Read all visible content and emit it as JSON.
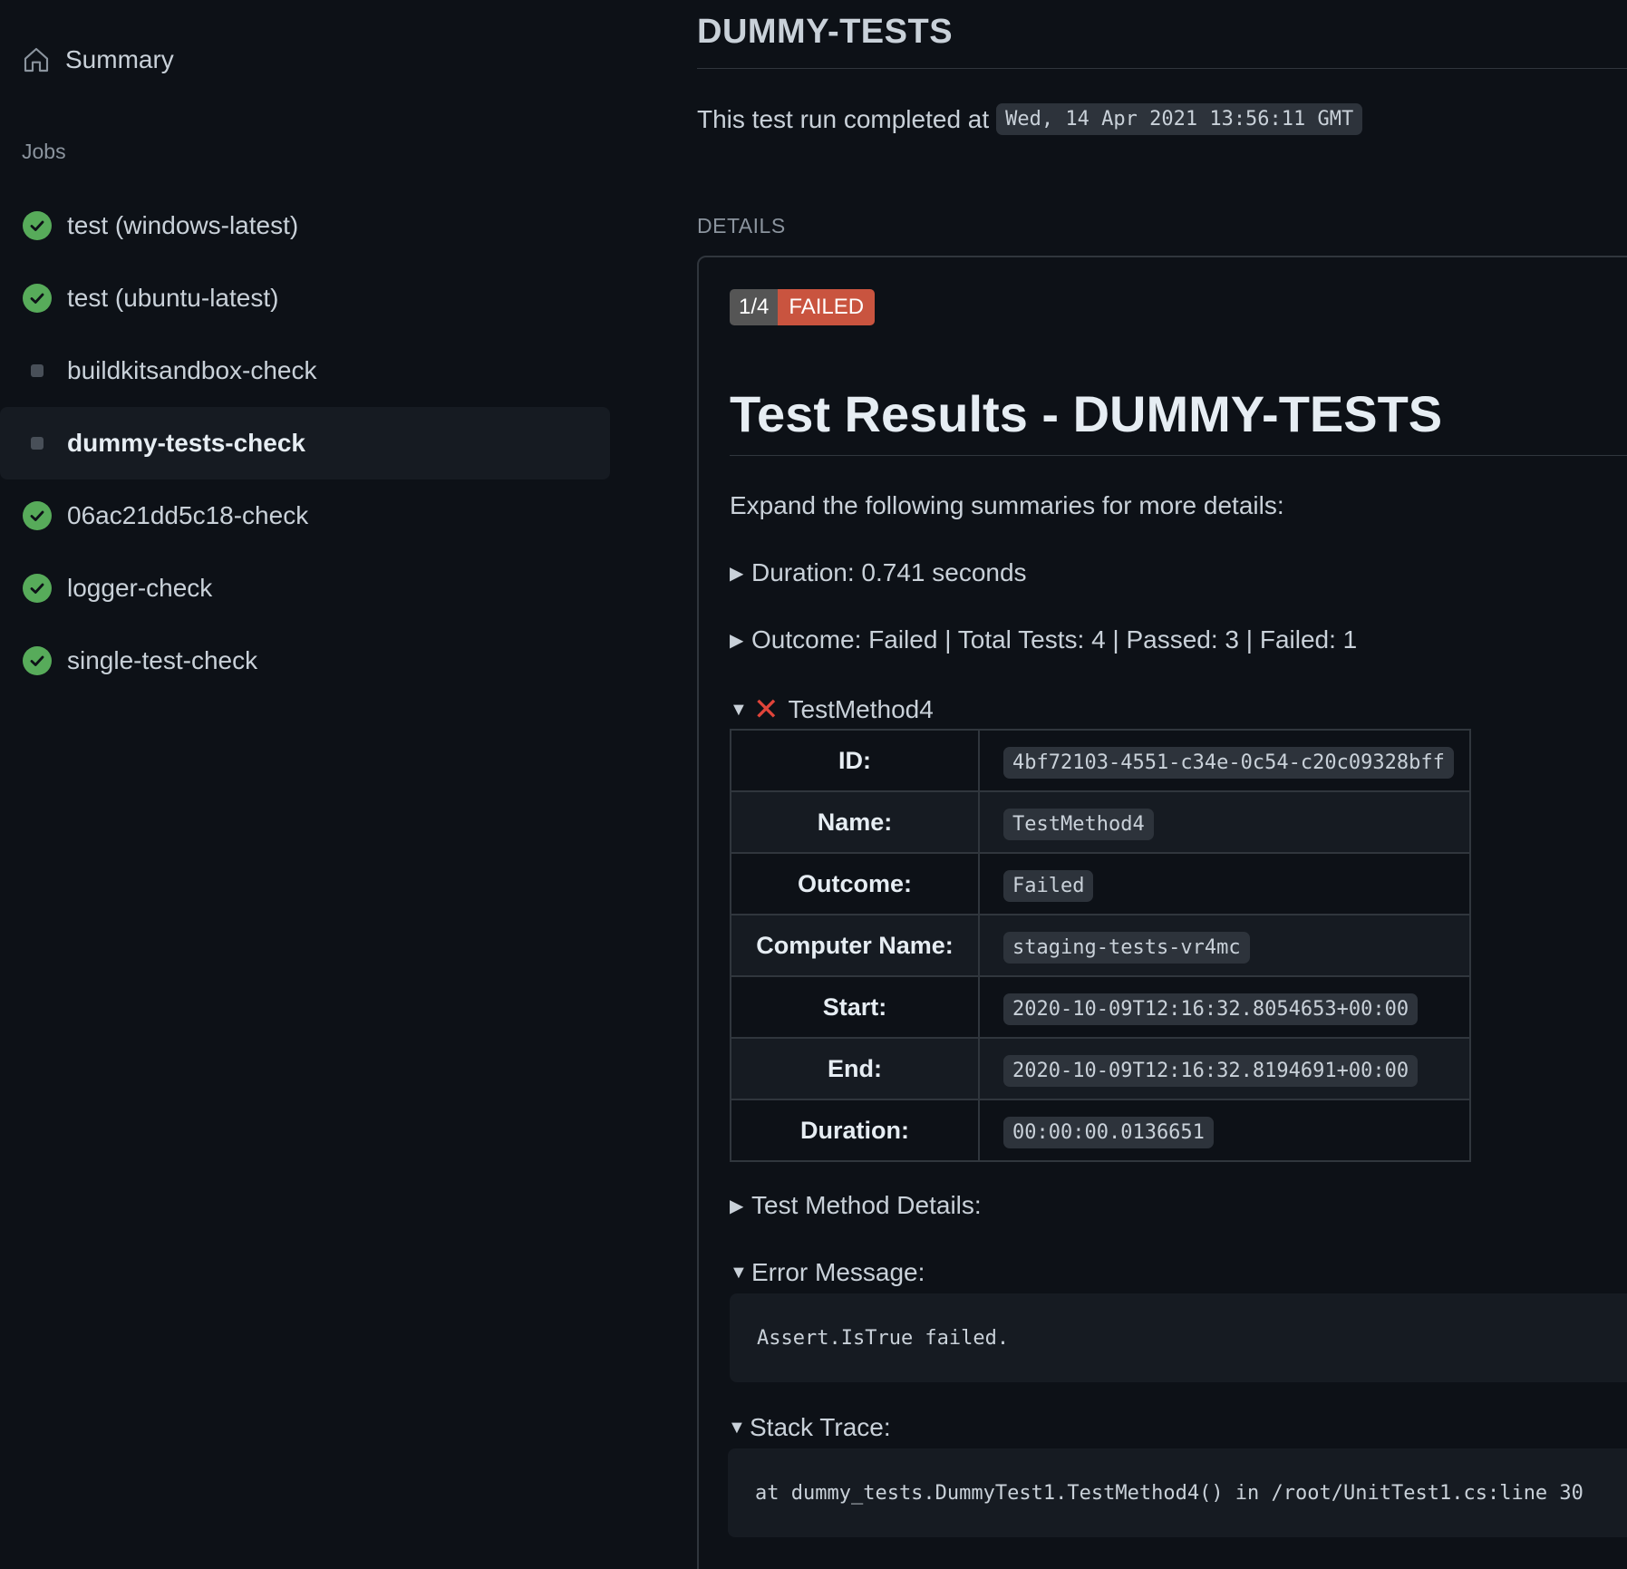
{
  "sidebar": {
    "summary_label": "Summary",
    "jobs_heading": "Jobs",
    "jobs": [
      {
        "label": "test (windows-latest)",
        "status": "success"
      },
      {
        "label": "test (ubuntu-latest)",
        "status": "success"
      },
      {
        "label": "buildkitsandbox-check",
        "status": "neutral"
      },
      {
        "label": "dummy-tests-check",
        "status": "neutral",
        "active": true
      },
      {
        "label": "06ac21dd5c18-check",
        "status": "success"
      },
      {
        "label": "logger-check",
        "status": "success"
      },
      {
        "label": "single-test-check",
        "status": "success"
      }
    ]
  },
  "main": {
    "title": "DUMMY-TESTS",
    "completed_text": "This test run completed at",
    "completed_time": "Wed, 14 Apr 2021 13:56:11 GMT",
    "details_label": "DETAILS",
    "badge_count": "1/4",
    "badge_status": "FAILED",
    "results_title": "Test Results - DUMMY-TESTS",
    "expand_text": "Expand the following summaries for more details:",
    "duration_summary": "Duration: 0.741 seconds",
    "outcome_summary": "Outcome: Failed | Total Tests: 4 | Passed: 3 | Failed: 1",
    "test_name": "TestMethod4",
    "test_table": [
      {
        "label": "ID:",
        "value": "4bf72103-4551-c34e-0c54-c20c09328bff"
      },
      {
        "label": "Name:",
        "value": "TestMethod4"
      },
      {
        "label": "Outcome:",
        "value": "Failed"
      },
      {
        "label": "Computer Name:",
        "value": "staging-tests-vr4mc"
      },
      {
        "label": "Start:",
        "value": "2020-10-09T12:16:32.8054653+00:00"
      },
      {
        "label": "End:",
        "value": "2020-10-09T12:16:32.8194691+00:00"
      },
      {
        "label": "Duration:",
        "value": "00:00:00.0136651"
      }
    ],
    "method_details_label": "Test Method Details:",
    "error_message_label": "Error Message:",
    "error_message": "Assert.IsTrue failed.",
    "stack_trace_label": "Stack Trace:",
    "stack_trace": "at dummy_tests.DummyTest1.TestMethod4() in /root/UnitTest1.cs:line 30"
  },
  "colors": {
    "background": "#0d1117",
    "success": "#57ab5a",
    "failed": "#c9543f",
    "error_icon": "#e0443a"
  }
}
